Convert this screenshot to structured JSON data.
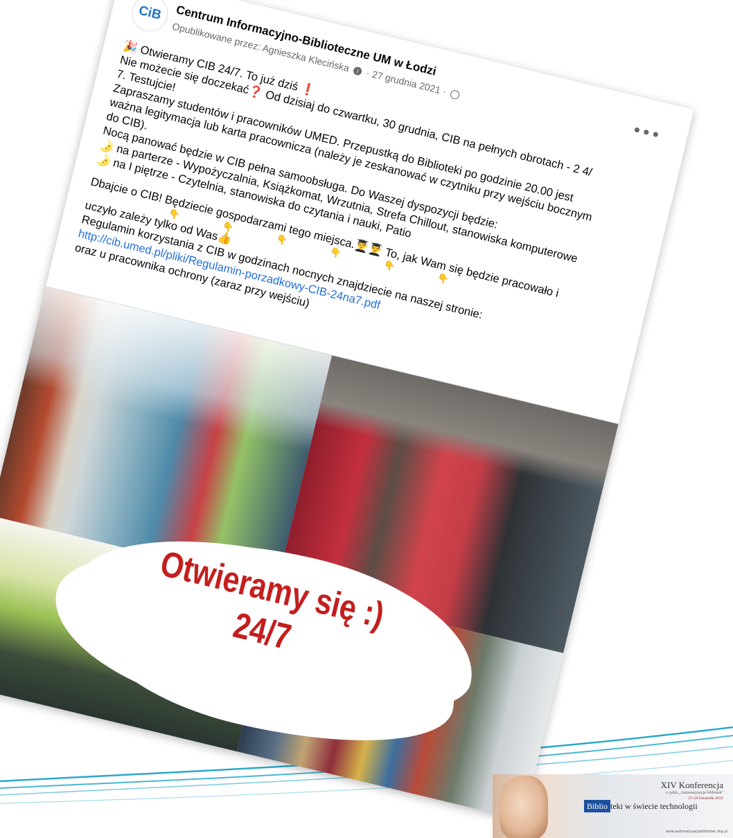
{
  "post": {
    "avatar_text": "CiB",
    "page_name": "Centrum Informacyjno-Biblioteczne UM w Łodzi",
    "posted_by": "Opublikowane przez: Agnieszka Klecińska",
    "date": "· 27 grudnia 2021 ·",
    "more_label": "•••",
    "lines": [
      "🎉 Otwieramy CIB 24/7. To już dziś ❗",
      "Nie możecie się doczekać❓ Od dzisiaj do czwartku, 30 grudnia, CIB na pełnych obrotach - 2 4/",
      "7. Testujcie!",
      "Zapraszamy studentów i pracowników UMED. Przepustką do Biblioteki po godzinie 20.00 jest",
      "ważna legitymacja lub karta pracownicza (należy je zeskanować w czytniku przy wejściu bocznym",
      "do CIB).",
      "Nocą panować będzie w CIB pełna samoobsługa. Do Waszej dyspozycji będzie:",
      "🌛 na parterze - Wypożyczalnia, Książkomat, Wrzutnia, Strefa Chillout, stanowiska komputerowe",
      "🌛 na I piętrze - Czytelnia, stanowiska do czytania i nauki, Patio"
    ],
    "hands": "👇 👇 👇 👇 👇 👇",
    "care_lines": [
      "Dbajcie o CIB! Będziecie gospodarzami tego miejsca.👨‍🎓👨‍🎓 To, jak Wam się będzie pracowało i",
      "uczyło zależy tylko od Was👍",
      "Regulamin korzystania z CIB w godzinach nocnych znajdziecie na naszej stronie:"
    ],
    "link": "http://cib.umed.pl/pliki/Regulamin-porzadkowy-CIB-24na7.pdf",
    "last_line": "oraz u pracownika ochrony (zaraz przy wejściu)",
    "image_overlay": {
      "line1": "Otwieramy się :)",
      "line2": "24/7"
    }
  },
  "conference": {
    "title": "XIV Konferencja",
    "subtitle": "z cyklu „Automatyzacja bibliotek\"",
    "dates": "23-24 listopada 2022",
    "tag_boxed": "Biblio",
    "tag_rest": "teki w świecie technologii",
    "url": "www.automatyzacjabibliotek.ohp.pl"
  },
  "colors": {
    "link": "#216fdb",
    "overlay_text": "#c41e1e",
    "swoosh": "#2aa8c9"
  }
}
